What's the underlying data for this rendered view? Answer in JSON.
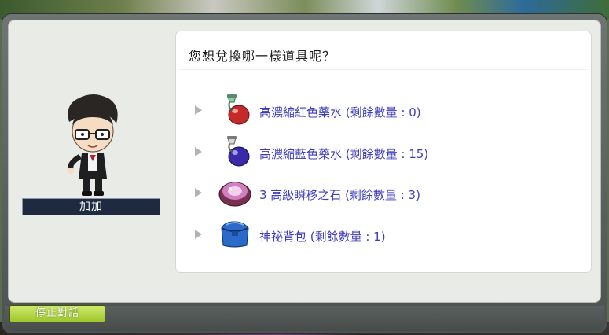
{
  "dialog": {
    "question": "您想兌換哪一樣道具呢？",
    "npc_name": "加加",
    "stop_button_label": "停止對話"
  },
  "options": [
    {
      "label": "高濃縮紅色藥水 (剩餘數量 : 0)",
      "icon": "red-potion-icon"
    },
    {
      "label": "高濃縮藍色藥水 (剩餘數量 : 15)",
      "icon": "blue-potion-icon"
    },
    {
      "label": "3 高級瞬移之石 (剩餘數量 : 3)",
      "icon": "teleport-rock-icon"
    },
    {
      "label": "神祕背包 (剩餘數量 : 1)",
      "icon": "mystery-bag-icon"
    }
  ],
  "colors": {
    "option_text": "#3d3bbd",
    "stop_button": "#b5d64a",
    "name_plate": "#1d2a40"
  }
}
